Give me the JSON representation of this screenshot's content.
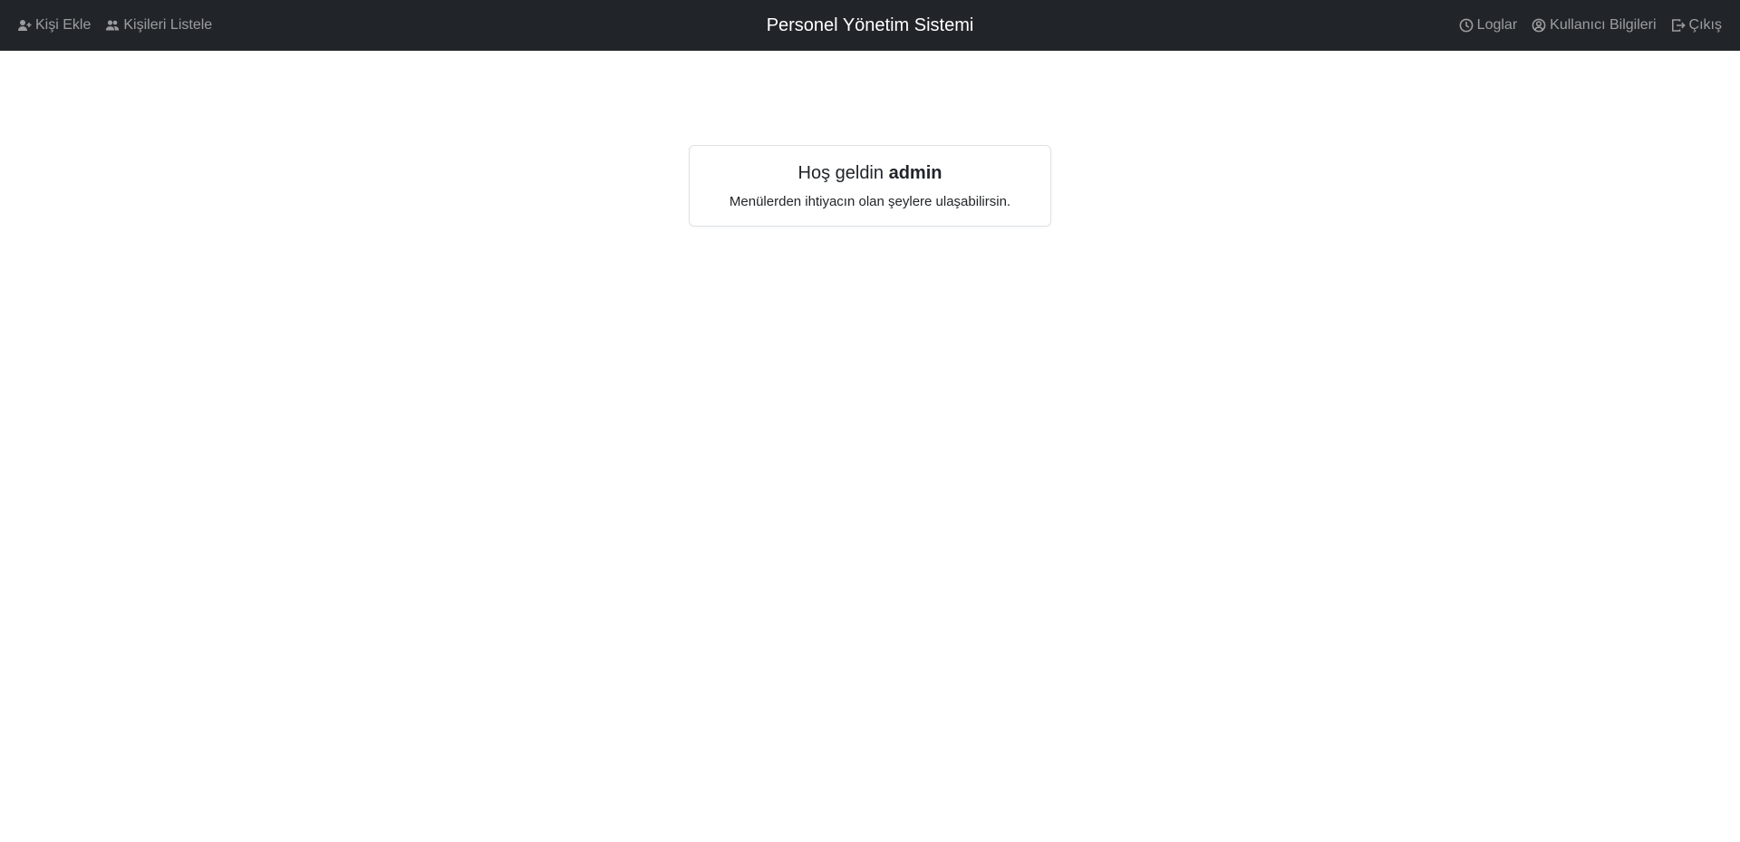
{
  "navbar": {
    "brand": "Personel Yönetim Sistemi",
    "left_items": [
      {
        "label": "Kişi Ekle",
        "icon": "user-plus-icon"
      },
      {
        "label": "Kişileri Listele",
        "icon": "users-icon"
      }
    ],
    "right_items": [
      {
        "label": "Loglar",
        "icon": "clock-icon"
      },
      {
        "label": "Kullanıcı Bilgileri",
        "icon": "user-circle-icon"
      },
      {
        "label": "Çıkış",
        "icon": "logout-icon"
      }
    ]
  },
  "welcome": {
    "greeting": "Hoş geldin",
    "username": "admin",
    "message": "Menülerden ihtiyacın olan şeylere ulaşabilirsin."
  }
}
